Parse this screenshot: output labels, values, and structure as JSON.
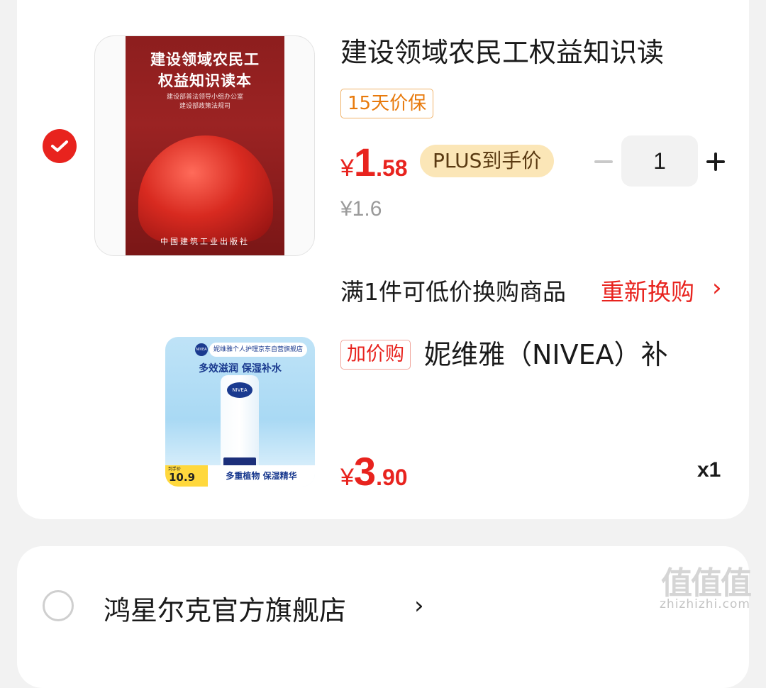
{
  "item1": {
    "selected": true,
    "title": "建设领域农民工权益知识读",
    "cover": {
      "title_line1": "建设领域农民工",
      "title_line2": "权益知识读本",
      "sub_line1": "建设部普法领导小组办公室",
      "sub_line2": "建设部政策法规司",
      "publisher": "中国建筑工业出版社"
    },
    "tag": "15天价保",
    "price": {
      "symbol": "¥",
      "integer": "1",
      "decimal": ".58"
    },
    "plus_label": "PLUS到手价",
    "original_price": "¥1.6",
    "quantity": "1"
  },
  "exchange": {
    "text": "满1件可低价换购商品",
    "link": "重新换购",
    "chevron": "›"
  },
  "item2": {
    "tag": "加价购",
    "title": "妮维雅（NIVEA）补",
    "image": {
      "brand": "NIVEA",
      "store": "妮维雅个人护理京东自营旗舰店",
      "slogan": "多效滋润  保湿补水",
      "bottom": "多重植物 保湿精华",
      "price_label": "到手价",
      "price_value": "10.9"
    },
    "price": {
      "symbol": "¥",
      "integer": "3",
      "decimal": ".90"
    },
    "count": "x1"
  },
  "store2": {
    "name": "鸿星尔克官方旗舰店",
    "chevron": "›",
    "selected": false
  },
  "watermark": {
    "logo": "值值值",
    "domain": "zhizhizhi.com"
  },
  "colors": {
    "accent_red": "#e8231e",
    "tag_orange": "#e87a0c",
    "plus_gold": "#fbe6b7"
  }
}
